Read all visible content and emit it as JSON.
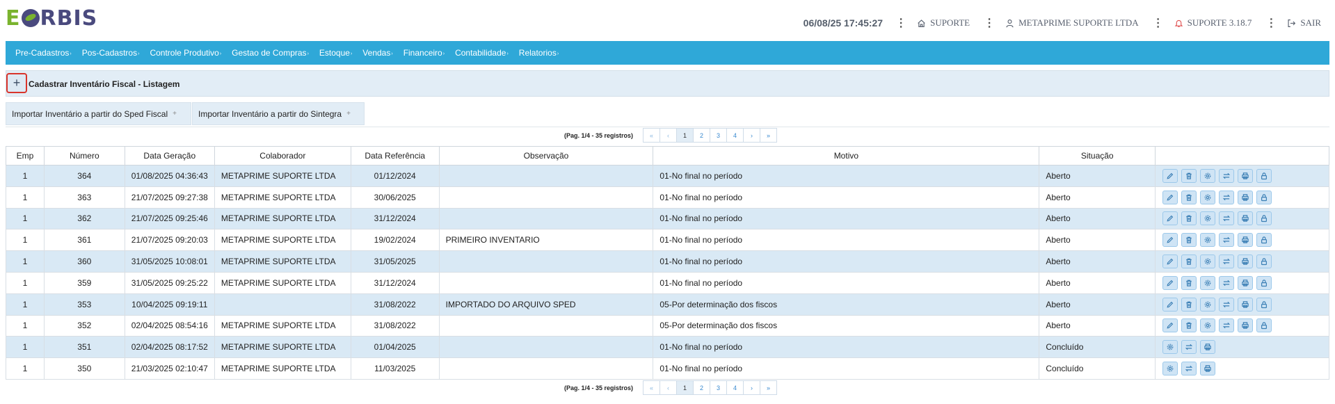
{
  "brand": {
    "name": "EORBIS"
  },
  "header": {
    "datetime": "06/08/25 17:45:27",
    "home_label": "SUPORTE",
    "user_label": "METAPRIME SUPORTE LTDA",
    "notify_label": "SUPORTE 3.18.7",
    "logout_label": "SAIR"
  },
  "menu": [
    "Pre-Cadastros",
    "Pos-Cadastros",
    "Controle Produtivo",
    "Gestao de Compras",
    "Estoque",
    "Vendas",
    "Financeiro",
    "Contabilidade",
    "Relatorios"
  ],
  "page": {
    "add_label": "+",
    "title": "Cadastrar Inventário Fiscal - Listagem"
  },
  "imports": {
    "sped": "Importar Inventário a partir do Sped Fiscal",
    "sintegra": "Importar Inventário a partir do Sintegra"
  },
  "pagination": {
    "info": "(Pag. 1/4 - 35 registros)",
    "first": "«",
    "prev": "‹",
    "pages": [
      "1",
      "2",
      "3",
      "4"
    ],
    "next": "›",
    "last": "»",
    "current": "1"
  },
  "table": {
    "columns": [
      "Emp",
      "Número",
      "Data Geração",
      "Colaborador",
      "Data Referência",
      "Observação",
      "Motivo",
      "Situação",
      ""
    ],
    "rows": [
      {
        "emp": "1",
        "numero": "364",
        "geracao": "01/08/2025 04:36:43",
        "colaborador": "METAPRIME SUPORTE LTDA",
        "referencia": "01/12/2024",
        "obs": "",
        "motivo": "01-No final no período",
        "situacao": "Aberto",
        "full": true
      },
      {
        "emp": "1",
        "numero": "363",
        "geracao": "21/07/2025 09:27:38",
        "colaborador": "METAPRIME SUPORTE LTDA",
        "referencia": "30/06/2025",
        "obs": "",
        "motivo": "01-No final no período",
        "situacao": "Aberto",
        "full": true
      },
      {
        "emp": "1",
        "numero": "362",
        "geracao": "21/07/2025 09:25:46",
        "colaborador": "METAPRIME SUPORTE LTDA",
        "referencia": "31/12/2024",
        "obs": "",
        "motivo": "01-No final no período",
        "situacao": "Aberto",
        "full": true
      },
      {
        "emp": "1",
        "numero": "361",
        "geracao": "21/07/2025 09:20:03",
        "colaborador": "METAPRIME SUPORTE LTDA",
        "referencia": "19/02/2024",
        "obs": "PRIMEIRO INVENTARIO",
        "motivo": "01-No final no período",
        "situacao": "Aberto",
        "full": true
      },
      {
        "emp": "1",
        "numero": "360",
        "geracao": "31/05/2025 10:08:01",
        "colaborador": "METAPRIME SUPORTE LTDA",
        "referencia": "31/05/2025",
        "obs": "",
        "motivo": "01-No final no período",
        "situacao": "Aberto",
        "full": true
      },
      {
        "emp": "1",
        "numero": "359",
        "geracao": "31/05/2025 09:25:22",
        "colaborador": "METAPRIME SUPORTE LTDA",
        "referencia": "31/12/2024",
        "obs": "",
        "motivo": "01-No final no período",
        "situacao": "Aberto",
        "full": true
      },
      {
        "emp": "1",
        "numero": "353",
        "geracao": "10/04/2025 09:19:11",
        "colaborador": "",
        "referencia": "31/08/2022",
        "obs": "IMPORTADO DO ARQUIVO SPED",
        "motivo": "05-Por determinação dos fiscos",
        "situacao": "Aberto",
        "full": true
      },
      {
        "emp": "1",
        "numero": "352",
        "geracao": "02/04/2025 08:54:16",
        "colaborador": "METAPRIME SUPORTE LTDA",
        "referencia": "31/08/2022",
        "obs": "",
        "motivo": "05-Por determinação dos fiscos",
        "situacao": "Aberto",
        "full": true
      },
      {
        "emp": "1",
        "numero": "351",
        "geracao": "02/04/2025 08:17:52",
        "colaborador": "METAPRIME SUPORTE LTDA",
        "referencia": "01/04/2025",
        "obs": "",
        "motivo": "01-No final no período",
        "situacao": "Concluído",
        "full": false
      },
      {
        "emp": "1",
        "numero": "350",
        "geracao": "21/03/2025 02:10:47",
        "colaborador": "METAPRIME SUPORTE LTDA",
        "referencia": "11/03/2025",
        "obs": "",
        "motivo": "01-No final no período",
        "situacao": "Concluído",
        "full": false
      }
    ],
    "actions_full": [
      "edit-icon",
      "trash-icon",
      "gear-icon",
      "transfer-icon",
      "print-icon",
      "lock-icon"
    ],
    "actions_closed": [
      "gear-icon",
      "transfer-icon",
      "print-icon"
    ]
  },
  "colors": {
    "menu": "#2fa8d8",
    "row_alt": "#d9e9f5",
    "add_border": "#d9342b"
  }
}
